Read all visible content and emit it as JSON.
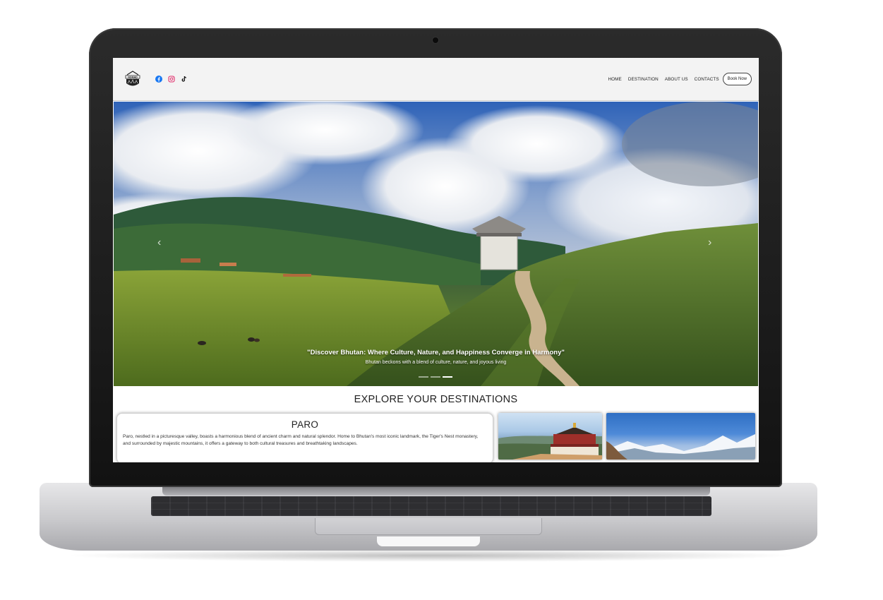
{
  "navbar": {
    "logo_text": "NOMAD",
    "social_icons": [
      "facebook-icon",
      "instagram-icon",
      "tiktok-icon"
    ],
    "links": [
      "HOME",
      "DESTINATION",
      "ABOUT US",
      "CONTACTS"
    ],
    "book_label": "Book Now"
  },
  "hero": {
    "title": "\"Discover Bhutan: Where Culture, Nature, and Happiness Converge in Harmony\"",
    "subtitle": "Bhutan beckons with a blend of culture, nature, and joyous living",
    "prev_icon": "chevron-left-icon",
    "next_icon": "chevron-right-icon",
    "slide_count": 3,
    "active_slide": 3
  },
  "explore": {
    "heading": "EXPLORE YOUR DESTINATIONS",
    "card": {
      "name": "PARO",
      "description": "Paro, nestled in a picturesque valley, boasts a harmonious blend of ancient charm and natural splendor. Home to Bhutan's most iconic landmark, the Tiger's Nest monastery, and surrounded by majestic mountains, it offers a gateway to both cultural treasures and breathtaking landscapes."
    }
  },
  "colors": {
    "navbar_bg": "#f3f3f3",
    "facebook": "#1877f2",
    "instagram": "#e1306c",
    "tiktok": "#111111"
  }
}
